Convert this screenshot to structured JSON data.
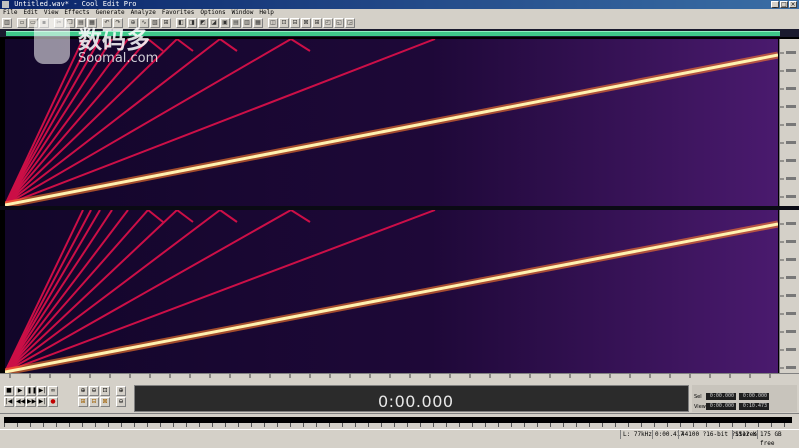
{
  "window": {
    "title": "Untitled.wav* - Cool Edit Pro",
    "buttons": [
      "_",
      "□",
      "×"
    ]
  },
  "menu": [
    "File",
    "Edit",
    "View",
    "Effects",
    "Generate",
    "Analyze",
    "Favorites",
    "Options",
    "Window",
    "Help"
  ],
  "main": {
    "time_display": "0:00.000"
  },
  "selection": {
    "rows": [
      {
        "label": "Sel",
        "begin": "0:00.000",
        "end": "0:00.000"
      },
      {
        "label": "View",
        "begin": "0:00.000",
        "end": "0:10.473"
      }
    ]
  },
  "status": {
    "items": [
      "L: 77kHz",
      "0:00.417",
      "44100 ?16-bit ?Stereo",
      "1512 K",
      "175 GB free"
    ]
  },
  "watermark": {
    "chinese": "数码多",
    "latin": "Soomal.com"
  },
  "colors": {
    "spectrum_background": "#1a0636",
    "sweep_main": "#fff2b0",
    "harmonics": "#e0104a",
    "overview_bar": "#3fc88a"
  }
}
